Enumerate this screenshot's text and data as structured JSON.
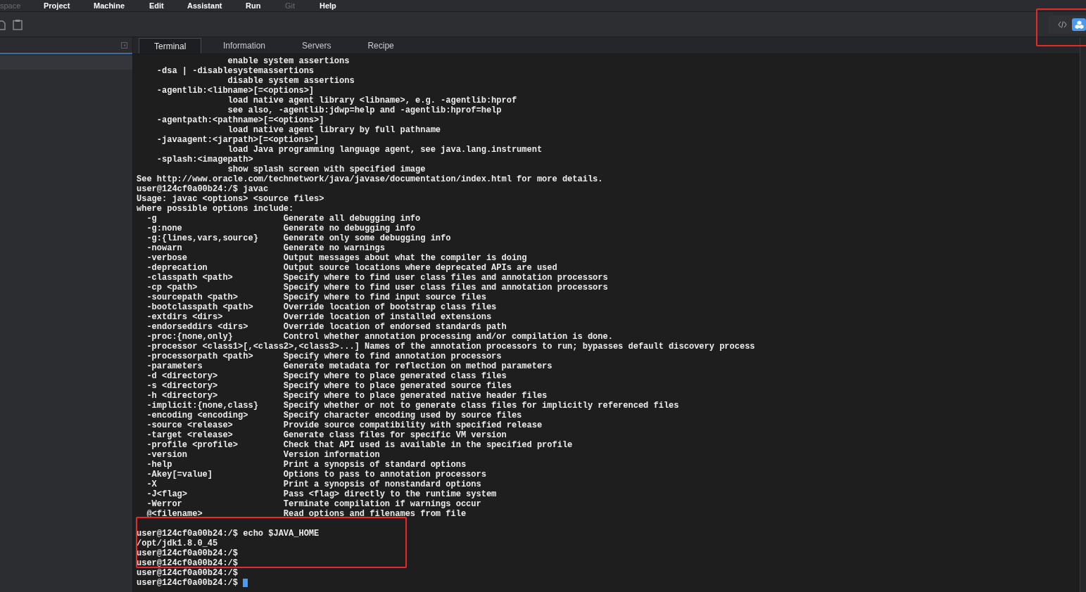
{
  "menu": [
    {
      "label": "space",
      "disabled": true
    },
    {
      "label": "Project",
      "disabled": false
    },
    {
      "label": "Machine",
      "disabled": false
    },
    {
      "label": "Edit",
      "disabled": false
    },
    {
      "label": "Assistant",
      "disabled": false
    },
    {
      "label": "Run",
      "disabled": false
    },
    {
      "label": "Git",
      "disabled": true
    },
    {
      "label": "Help",
      "disabled": false
    }
  ],
  "tabs": [
    {
      "label": "Terminal",
      "selected": true
    },
    {
      "label": "Information",
      "selected": false
    },
    {
      "label": "Servers",
      "selected": false
    },
    {
      "label": "Recipe",
      "selected": false
    }
  ],
  "view_switch": [
    {
      "kind": "code",
      "selected": false
    },
    {
      "kind": "cubes",
      "selected": true
    }
  ],
  "terminal": {
    "lines": [
      "                  enable system assertions",
      "    -dsa | -disablesystemassertions",
      "                  disable system assertions",
      "    -agentlib:<libname>[=<options>]",
      "                  load native agent library <libname>, e.g. -agentlib:hprof",
      "                  see also, -agentlib:jdwp=help and -agentlib:hprof=help",
      "    -agentpath:<pathname>[=<options>]",
      "                  load native agent library by full pathname",
      "    -javaagent:<jarpath>[=<options>]",
      "                  load Java programming language agent, see java.lang.instrument",
      "    -splash:<imagepath>",
      "                  show splash screen with specified image",
      "See http://www.oracle.com/technetwork/java/javase/documentation/index.html for more details.",
      "user@124cf0a00b24:/$ javac",
      "Usage: javac <options> <source files>",
      "where possible options include:",
      "  -g                         Generate all debugging info",
      "  -g:none                    Generate no debugging info",
      "  -g:{lines,vars,source}     Generate only some debugging info",
      "  -nowarn                    Generate no warnings",
      "  -verbose                   Output messages about what the compiler is doing",
      "  -deprecation               Output source locations where deprecated APIs are used",
      "  -classpath <path>          Specify where to find user class files and annotation processors",
      "  -cp <path>                 Specify where to find user class files and annotation processors",
      "  -sourcepath <path>         Specify where to find input source files",
      "  -bootclasspath <path>      Override location of bootstrap class files",
      "  -extdirs <dirs>            Override location of installed extensions",
      "  -endorseddirs <dirs>       Override location of endorsed standards path",
      "  -proc:{none,only}          Control whether annotation processing and/or compilation is done.",
      "  -processor <class1>[,<class2>,<class3>...] Names of the annotation processors to run; bypasses default discovery process",
      "  -processorpath <path>      Specify where to find annotation processors",
      "  -parameters                Generate metadata for reflection on method parameters",
      "  -d <directory>             Specify where to place generated class files",
      "  -s <directory>             Specify where to place generated source files",
      "  -h <directory>             Specify where to place generated native header files",
      "  -implicit:{none,class}     Specify whether or not to generate class files for implicitly referenced files",
      "  -encoding <encoding>       Specify character encoding used by source files",
      "  -source <release>          Provide source compatibility with specified release",
      "  -target <release>          Generate class files for specific VM version",
      "  -profile <profile>         Check that API used is available in the specified profile",
      "  -version                   Version information",
      "  -help                      Print a synopsis of standard options",
      "  -Akey[=value]              Options to pass to annotation processors",
      "  -X                         Print a synopsis of nonstandard options",
      "  -J<flag>                   Pass <flag> directly to the runtime system",
      "  -Werror                    Terminate compilation if warnings occur",
      "  @<filename>                Read options and filenames from file"
    ],
    "session": [
      "user@124cf0a00b24:/$ echo $JAVA_HOME",
      "/opt/jdk1.8.0_45",
      "user@124cf0a00b24:/$",
      "user@124cf0a00b24:/$",
      "user@124cf0a00b24:/$",
      "user@124cf0a00b24:/$ "
    ],
    "cursor": true
  }
}
